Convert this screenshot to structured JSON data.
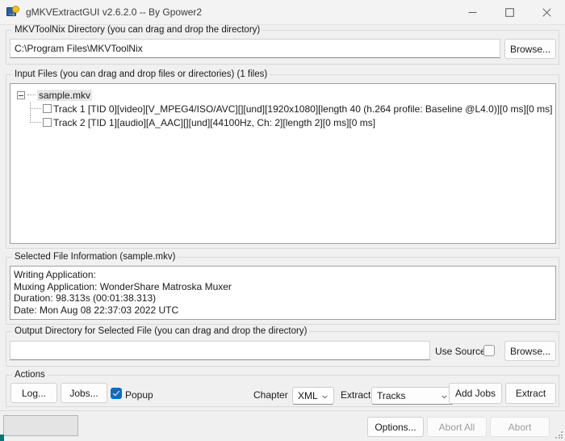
{
  "window": {
    "title": "gMKVExtractGUI v2.6.2.0 -- By Gpower2",
    "icon": "app-icon",
    "minimize_label": "─",
    "maximize_label": "□",
    "close_label": "✕"
  },
  "mkvtoolnix": {
    "group_label": "MKVToolNix Directory (you can drag and drop the directory)",
    "path_value": "C:\\Program Files\\MKVToolNix",
    "path_placeholder": "",
    "browse_label": "Browse..."
  },
  "input_files": {
    "group_label": "Input Files (you can drag and drop files or directories) (1 files)",
    "root_name": "sample.mkv",
    "tracks": [
      {
        "checked": false,
        "label": "Track 1 [TID 0][video][V_MPEG4/ISO/AVC][][und][1920x1080][length 40 (h.264 profile: Baseline @L4.0)][0 ms][0 ms]"
      },
      {
        "checked": false,
        "label": "Track 2 [TID 1][audio][A_AAC][][und][44100Hz, Ch: 2][length 2][0 ms][0 ms]"
      }
    ]
  },
  "selected_file_info": {
    "group_label": "Selected File Information (sample.mkv)",
    "lines": [
      "Writing Application:",
      "Muxing Application: WonderShare Matroska Muxer",
      "Duration: 98.313s (00:01:38.313)",
      "Date: Mon Aug 08 22:37:03 2022 UTC"
    ],
    "text": "Writing Application:\nMuxing Application: WonderShare Matroska Muxer\nDuration: 98.313s (00:01:38.313)\nDate: Mon Aug 08 22:37:03 2022 UTC"
  },
  "output_directory": {
    "group_label": "Output Directory for Selected File (you can drag and drop the directory)",
    "path_value": "",
    "path_placeholder": "",
    "use_source_label": "Use Source",
    "use_source_checked": false,
    "browse_label": "Browse..."
  },
  "actions": {
    "group_label": "Actions",
    "log_label": "Log...",
    "jobs_label": "Jobs...",
    "popup_label": "Popup",
    "popup_checked": true,
    "chapter_label": "Chapter",
    "chapter_value": "XML",
    "chapter_options": [
      "XML"
    ],
    "extract_label": "Extract",
    "extract_value": "Tracks",
    "extract_options": [
      "Tracks"
    ],
    "add_jobs_label": "Add Jobs",
    "extract_button_label": "Extract"
  },
  "statusbar": {
    "progress_text": "",
    "options_label": "Options...",
    "abort_all_label": "Abort All",
    "abort_all_enabled": false,
    "abort_label": "Abort",
    "abort_enabled": false
  },
  "colors": {
    "window_bg": "#f0f0f0",
    "titlebar_bg": "#f3f3f3",
    "accent_checkbox": "#0f6cbd",
    "panel_white": "#ffffff",
    "border_grey": "#d9d9d9",
    "selection_grey": "#e6e6e6",
    "disabled_text": "#9d9d9d"
  }
}
